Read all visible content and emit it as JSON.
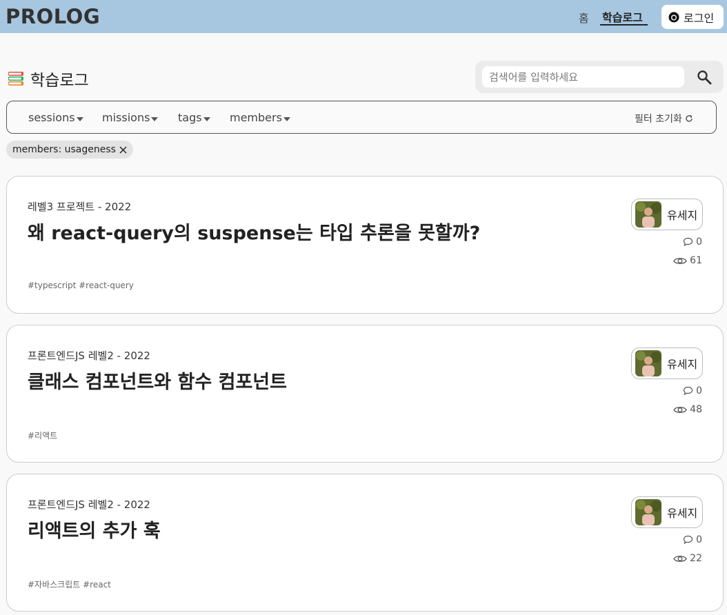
{
  "header": {
    "logo": "PROLOG",
    "nav_home": "홈",
    "nav_log": "학습로그",
    "login_label": "로그인"
  },
  "page": {
    "title": "학습로그"
  },
  "search": {
    "placeholder": "검색어를 입력하세요",
    "value": ""
  },
  "filters": {
    "items": [
      "sessions",
      "missions",
      "tags",
      "members"
    ],
    "reset_label": "필터 초기화"
  },
  "active_filter": {
    "label": "members: usageness"
  },
  "posts": [
    {
      "meta": "레벨3 프로젝트 - 2022",
      "title": "왜 react-query의 suspense는 타입 추론을 못할까?",
      "tags": "#typescript #react-query",
      "author": "유세지",
      "comments": "0",
      "views": "61"
    },
    {
      "meta": "프론트엔드JS 레벨2 - 2022",
      "title": "클래스 컴포넌트와 함수 컴포넌트",
      "tags": "#리액트",
      "author": "유세지",
      "comments": "0",
      "views": "48"
    },
    {
      "meta": "프론트엔드JS 레벨2 - 2022",
      "title": "리액트의 추가 훅",
      "tags": "#자바스크립트 #react",
      "author": "유세지",
      "comments": "0",
      "views": "22"
    }
  ],
  "colors": {
    "header_bg": "#a7c7e1",
    "page_bg": "#f9f9f9",
    "card_border": "#cccccc"
  }
}
